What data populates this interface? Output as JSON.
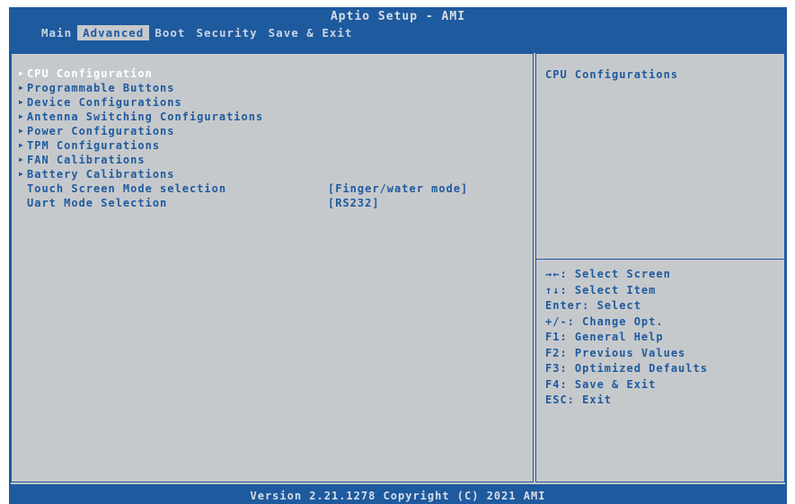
{
  "app": {
    "title": "Aptio Setup - AMI",
    "footer": "Version 2.21.1278 Copyright (C) 2021 AMI"
  },
  "tabs": [
    {
      "label": "Main",
      "active": false
    },
    {
      "label": "Advanced",
      "active": true
    },
    {
      "label": "Boot",
      "active": false
    },
    {
      "label": "Security",
      "active": false
    },
    {
      "label": "Save & Exit",
      "active": false
    }
  ],
  "menu": {
    "arrow_glyph": "▶",
    "items": [
      {
        "label": "CPU Configuration",
        "submenu": true,
        "selected": true
      },
      {
        "label": "Programmable Buttons",
        "submenu": true,
        "selected": false
      },
      {
        "label": "Device Configurations",
        "submenu": true,
        "selected": false
      },
      {
        "label": "Antenna Switching Configurations",
        "submenu": true,
        "selected": false
      },
      {
        "label": "Power Configurations",
        "submenu": true,
        "selected": false
      },
      {
        "label": "TPM Configurations",
        "submenu": true,
        "selected": false
      },
      {
        "label": "FAN Calibrations",
        "submenu": true,
        "selected": false
      },
      {
        "label": "Battery Calibrations",
        "submenu": true,
        "selected": false
      },
      {
        "label": "Touch Screen Mode selection",
        "submenu": false,
        "selected": false,
        "value": "[Finger/water mode]"
      },
      {
        "label": "Uart Mode Selection",
        "submenu": false,
        "selected": false,
        "value": "[RS232]"
      }
    ]
  },
  "help": {
    "title": "CPU Configurations",
    "keys": [
      "→←: Select Screen",
      "↑↓: Select Item",
      "Enter: Select",
      "+/-: Change Opt.",
      "F1: General Help",
      "F2: Previous Values",
      "F3: Optimized Defaults",
      "F4: Save & Exit",
      "ESC: Exit"
    ]
  },
  "colors": {
    "frame": "#1e5a9e",
    "panel": "#c6c9cc",
    "text": "#1e5a9e",
    "selected_text": "#ffffff"
  }
}
